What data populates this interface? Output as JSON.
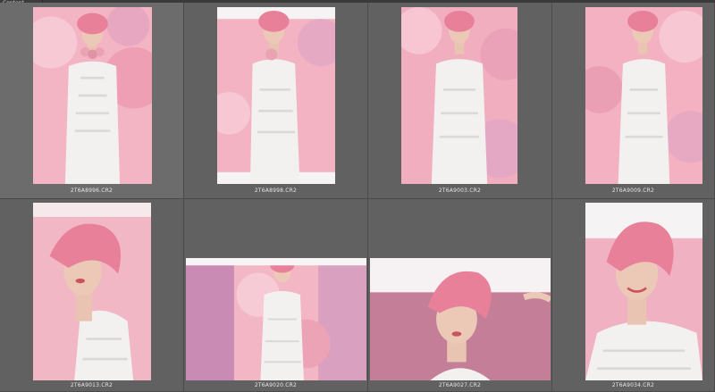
{
  "panel": {
    "tab_label": "Content"
  },
  "thumbnails": [
    {
      "filename": "2T6A8996.CR2",
      "selected": true
    },
    {
      "filename": "2T6A8998.CR2",
      "selected": false
    },
    {
      "filename": "2T6A9003.CR2",
      "selected": false
    },
    {
      "filename": "2T6A9009.CR2",
      "selected": false
    },
    {
      "filename": "2T6A9013.CR2",
      "selected": false
    },
    {
      "filename": "2T6A9020.CR2",
      "selected": false
    },
    {
      "filename": "2T6A9027.CR2",
      "selected": false
    },
    {
      "filename": "2T6A9034.CR2",
      "selected": false
    }
  ],
  "colors": {
    "background": "#5a5a5a",
    "cell": "#616161",
    "hair": "#e8809a",
    "backdrop": "#f4b8c6",
    "dress": "#f3f1f0"
  }
}
